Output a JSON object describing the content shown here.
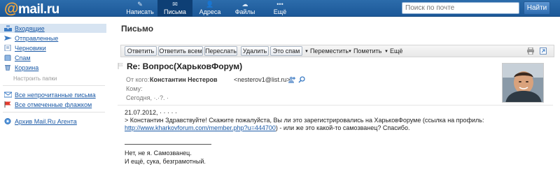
{
  "header": {
    "logo_text": "mail.ru",
    "nav": [
      {
        "label": "Написать",
        "icon": "pencil-icon"
      },
      {
        "label": "Письма",
        "icon": "envelope-icon"
      },
      {
        "label": "Адреса",
        "icon": "contacts-icon"
      },
      {
        "label": "Файлы",
        "icon": "files-icon"
      },
      {
        "label": "Ещё",
        "icon": "more-dots-icon"
      }
    ],
    "search_placeholder": "Поиск по почте",
    "search_button": "Найти"
  },
  "sidebar": {
    "folders": [
      {
        "label": "Входящие",
        "icon": "inbox-icon",
        "active": true
      },
      {
        "label": "Отправленные",
        "icon": "sent-icon"
      },
      {
        "label": "Черновики",
        "icon": "drafts-icon"
      },
      {
        "label": "Спам",
        "icon": "spam-icon"
      },
      {
        "label": "Корзина",
        "icon": "trash-icon"
      }
    ],
    "settings_link": "Настроить папки",
    "filters": [
      {
        "label": "Все непрочитанные письма",
        "icon": "unread-icon"
      },
      {
        "label": "Все отмеченные флажком",
        "icon": "flag-icon"
      }
    ],
    "agent_link": "Архив Mail.Ru Агента"
  },
  "main": {
    "title": "Письмо",
    "toolbar": {
      "reply": "Ответить",
      "reply_all": "Ответить всем",
      "forward": "Переслать",
      "delete": "Удалить",
      "spam": "Это спам",
      "move": "Переместить",
      "mark": "Пометить",
      "more": "Ещё"
    },
    "message": {
      "subject": "Re: Вопрос(ХарьковФорум)",
      "from_label": "От кого:",
      "from_name": "Константин Нестеров",
      "from_email": "<nesterov1@list.ru>",
      "to_label": "Кому:",
      "date_text": "Сегодня, ·.·?.  ·",
      "body": {
        "line1": "21.07.2012, ·  ·   ·   ·  ·",
        "line2": "> Константин Здравствуйте! Скажите пожалуйста, Вы ли это зарегистрировались на ХарьковФоруме (ссылка на профиль:",
        "link": "http://www.kharkovforum.com/member.php?u=444700",
        "line3_suffix": ") - или же это какой-то самозванец? Спасибо.",
        "line4": "Нет, не я. Самозванец.",
        "line5": "И ещё, сука, безграмотный."
      }
    }
  }
}
